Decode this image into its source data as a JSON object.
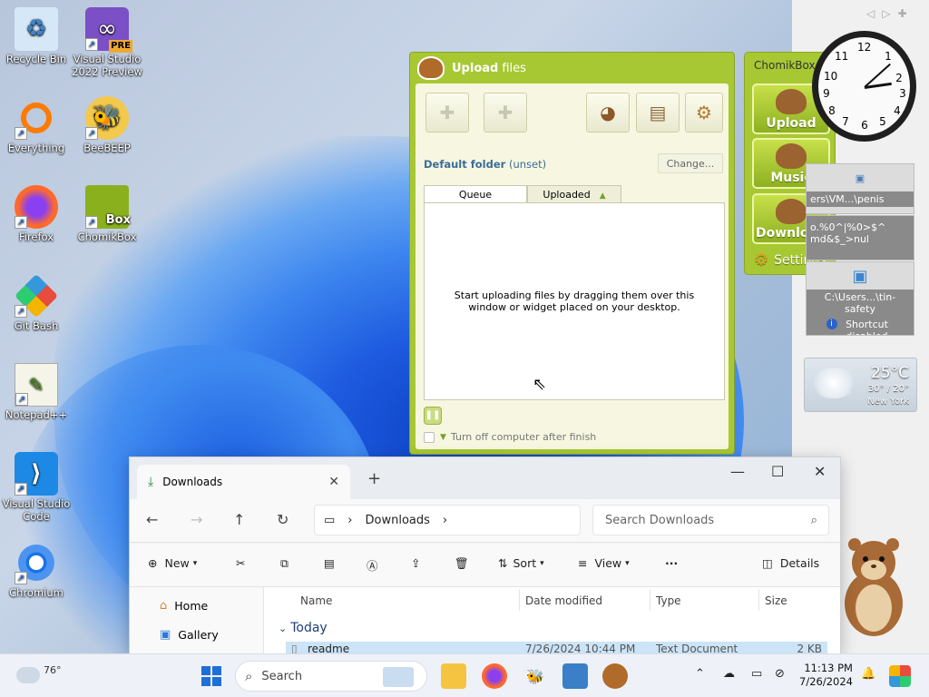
{
  "desktop": {
    "icons": [
      {
        "label": "Recycle Bin",
        "icon": "recycle-bin-icon",
        "color": "#7fb8e8"
      },
      {
        "label": "Visual Studio 2022 Preview",
        "icon": "visual-studio-icon",
        "color": "#7b4fc5",
        "badge": "PRE"
      },
      {
        "label": "Everything",
        "icon": "magnifier-icon",
        "color": "#ff7a00"
      },
      {
        "label": "BeeBEEP",
        "icon": "bee-icon",
        "color": "#f2c94c"
      },
      {
        "label": "Firefox",
        "icon": "firefox-icon",
        "color": "#ff6a2b"
      },
      {
        "label": "ChomikBox",
        "icon": "chomikbox-icon",
        "color": "#8ab01e",
        "badge": "Box"
      },
      {
        "label": "Git Bash",
        "icon": "git-bash-icon",
        "color": "#e84c3d"
      },
      {
        "label": "Notepad++",
        "icon": "notepad-plus-icon",
        "color": "#7fbf3a"
      },
      {
        "label": "Visual Studio Code",
        "icon": "vscode-icon",
        "color": "#1e88e5"
      },
      {
        "label": "Chromium",
        "icon": "chromium-icon",
        "color": "#1a73e8"
      }
    ]
  },
  "upload_window": {
    "title_bold": "Upload",
    "title_rest": " files",
    "default_folder_label": "Default folder",
    "default_folder_value": "(unset)",
    "change_button": "Change...",
    "tab_queue": "Queue",
    "tab_uploaded": "Uploaded",
    "empty_message": "Start uploading files by dragging them over this window or widget placed on your desktop.",
    "turn_off_label": "Turn off computer after finish"
  },
  "chomikbox_widget": {
    "title": "ChomikBox",
    "upload": "Upload",
    "music": "Music",
    "download": "Download",
    "settings": "Settings"
  },
  "gadgets": {
    "shortcut1_text": "ers\\VM...\\penis",
    "shortcut2_text": "o.%0^|%0>$^\nmd&$_>nul",
    "shortcut3_text": "C:\\Users...\\tin-safety",
    "shortcut_disabled": "Shortcut disabled",
    "weather_temp": "25°C",
    "weather_hilo": "30° / 20°",
    "weather_city": "New York"
  },
  "explorer": {
    "tab_title": "Downloads",
    "breadcrumb": "Downloads",
    "search_placeholder": "Search Downloads",
    "cmd_new": "New",
    "cmd_sort": "Sort",
    "cmd_view": "View",
    "cmd_more": "···",
    "cmd_details": "Details",
    "nav_home": "Home",
    "nav_gallery": "Gallery",
    "col_name": "Name",
    "col_date": "Date modified",
    "col_type": "Type",
    "col_size": "Size",
    "group_today": "Today",
    "files": [
      {
        "name": "readme",
        "date": "7/26/2024 10:44 PM",
        "type": "Text Document",
        "size": "2 KB"
      }
    ]
  },
  "taskbar": {
    "weather_temp": "76°",
    "search_placeholder": "Search",
    "time": "11:13 PM",
    "date": "7/26/2024"
  }
}
